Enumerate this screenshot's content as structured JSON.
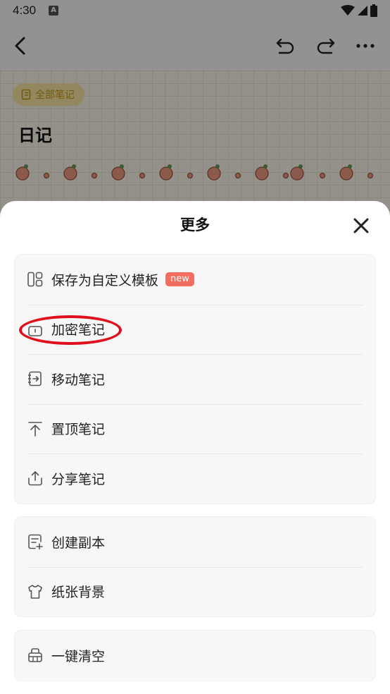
{
  "status_bar": {
    "time": "4:30",
    "app_icon_letter": "A"
  },
  "top_bar": {
    "back_icon": "chevron-left-icon",
    "undo_icon": "undo-icon",
    "redo_icon": "redo-icon",
    "more_icon": "more-horizontal-icon"
  },
  "note": {
    "folder_label": "全部笔记",
    "title": "日记"
  },
  "sheet": {
    "title": "更多",
    "groups": [
      {
        "items": [
          {
            "label": "保存为自定义模板",
            "icon": "template-icon",
            "badge": "new"
          },
          {
            "label": "加密笔记",
            "icon": "lock-icon"
          },
          {
            "label": "移动笔记",
            "icon": "move-note-icon"
          },
          {
            "label": "置顶笔记",
            "icon": "pin-top-icon"
          },
          {
            "label": "分享笔记",
            "icon": "share-icon"
          }
        ]
      },
      {
        "items": [
          {
            "label": "创建副本",
            "icon": "copy-note-icon"
          },
          {
            "label": "纸张背景",
            "icon": "paper-background-icon"
          }
        ]
      },
      {
        "items": [
          {
            "label": "一键清空",
            "icon": "clear-basket-icon"
          }
        ]
      }
    ]
  },
  "colors": {
    "accent_badge": "#f46d5e",
    "annotation": "#e0101a",
    "folder_chip": "#fde9a6"
  }
}
